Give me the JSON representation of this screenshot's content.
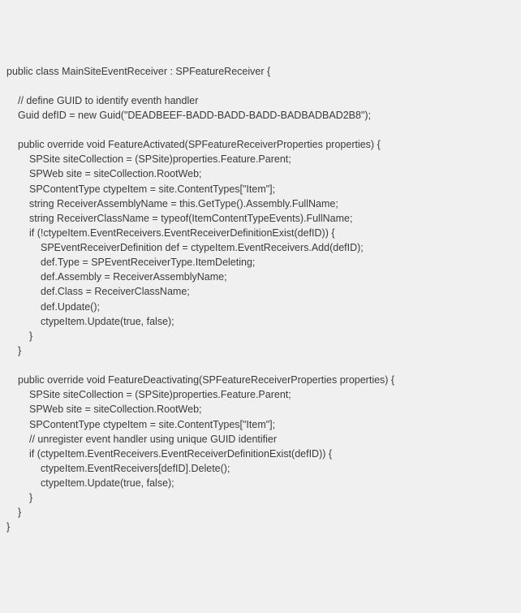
{
  "code": {
    "lines": [
      {
        "indent": 0,
        "text": "public class MainSiteEventReceiver : SPFeatureReceiver {"
      },
      {
        "indent": 0,
        "text": ""
      },
      {
        "indent": 1,
        "text": "// define GUID to identify eventh handler"
      },
      {
        "indent": 1,
        "text": "Guid defID = new Guid(\"DEADBEEF-BADD-BADD-BADD-BADBADBAD2B8\");"
      },
      {
        "indent": 0,
        "text": ""
      },
      {
        "indent": 1,
        "text": "public override void FeatureActivated(SPFeatureReceiverProperties properties) {"
      },
      {
        "indent": 2,
        "text": "SPSite siteCollection = (SPSite)properties.Feature.Parent;"
      },
      {
        "indent": 2,
        "text": "SPWeb site = siteCollection.RootWeb;"
      },
      {
        "indent": 2,
        "text": "SPContentType ctypeItem = site.ContentTypes[\"Item\"];"
      },
      {
        "indent": 2,
        "text": "string ReceiverAssemblyName = this.GetType().Assembly.FullName;"
      },
      {
        "indent": 2,
        "text": "string ReceiverClassName = typeof(ItemContentTypeEvents).FullName;"
      },
      {
        "indent": 2,
        "text": "if (!ctypeItem.EventReceivers.EventReceiverDefinitionExist(defID)) {"
      },
      {
        "indent": 3,
        "text": "SPEventReceiverDefinition def = ctypeItem.EventReceivers.Add(defID);"
      },
      {
        "indent": 3,
        "text": "def.Type = SPEventReceiverType.ItemDeleting;"
      },
      {
        "indent": 3,
        "text": "def.Assembly = ReceiverAssemblyName;"
      },
      {
        "indent": 3,
        "text": "def.Class = ReceiverClassName;"
      },
      {
        "indent": 3,
        "text": "def.Update();"
      },
      {
        "indent": 3,
        "text": "ctypeItem.Update(true, false);"
      },
      {
        "indent": 2,
        "text": "}"
      },
      {
        "indent": 1,
        "text": "}"
      },
      {
        "indent": 0,
        "text": ""
      },
      {
        "indent": 1,
        "text": "public override void FeatureDeactivating(SPFeatureReceiverProperties properties) {"
      },
      {
        "indent": 2,
        "text": "SPSite siteCollection = (SPSite)properties.Feature.Parent;"
      },
      {
        "indent": 2,
        "text": "SPWeb site = siteCollection.RootWeb;"
      },
      {
        "indent": 2,
        "text": "SPContentType ctypeItem = site.ContentTypes[\"Item\"];"
      },
      {
        "indent": 2,
        "text": "// unregister event handler using unique GUID identifier"
      },
      {
        "indent": 2,
        "text": "if (ctypeItem.EventReceivers.EventReceiverDefinitionExist(defID)) {"
      },
      {
        "indent": 3,
        "text": "ctypeItem.EventReceivers[defID].Delete();"
      },
      {
        "indent": 3,
        "text": "ctypeItem.Update(true, false);"
      },
      {
        "indent": 2,
        "text": "}"
      },
      {
        "indent": 1,
        "text": "}"
      },
      {
        "indent": 0,
        "text": "}"
      }
    ]
  }
}
